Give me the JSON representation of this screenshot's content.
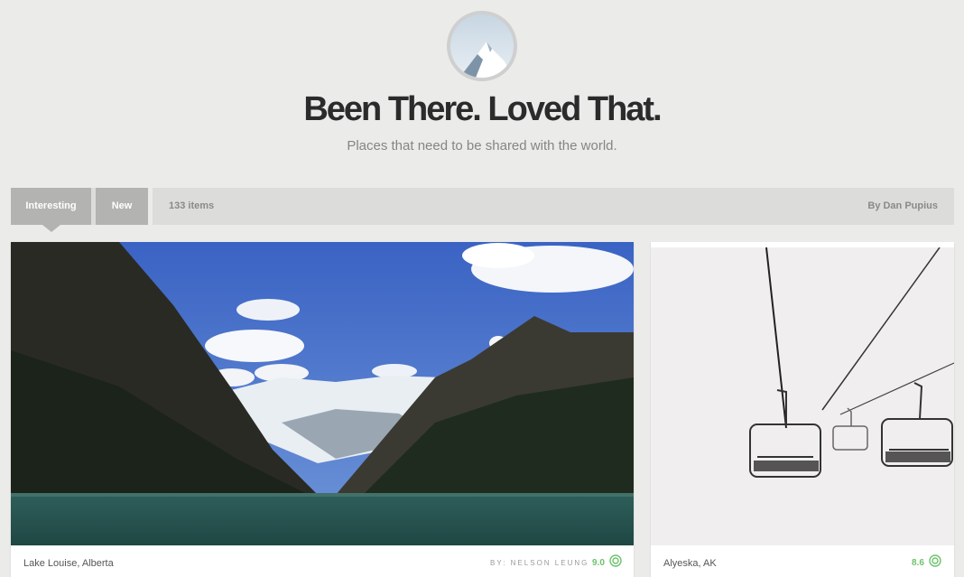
{
  "header": {
    "title": "Been There. Loved That.",
    "subtitle": "Places that need to be shared with the world."
  },
  "toolbar": {
    "tabs": [
      {
        "label": "Interesting",
        "active": true
      },
      {
        "label": "New",
        "active": false
      }
    ],
    "count": "133 items",
    "author": "By Dan Pupius"
  },
  "cards": [
    {
      "location": "Lake Louise, Alberta",
      "byline": "BY: NELSON LEUNG",
      "score": "9.0",
      "score_icon": "target-icon"
    },
    {
      "location": "Alyeska, AK",
      "score": "8.6",
      "score_icon": "target-icon"
    }
  ],
  "colors": {
    "background": "#ebebea",
    "toolbar": "#dcdcdb",
    "tab": "#b3b3b2",
    "score": "#6cc26c",
    "title": "#2b2b2b"
  }
}
